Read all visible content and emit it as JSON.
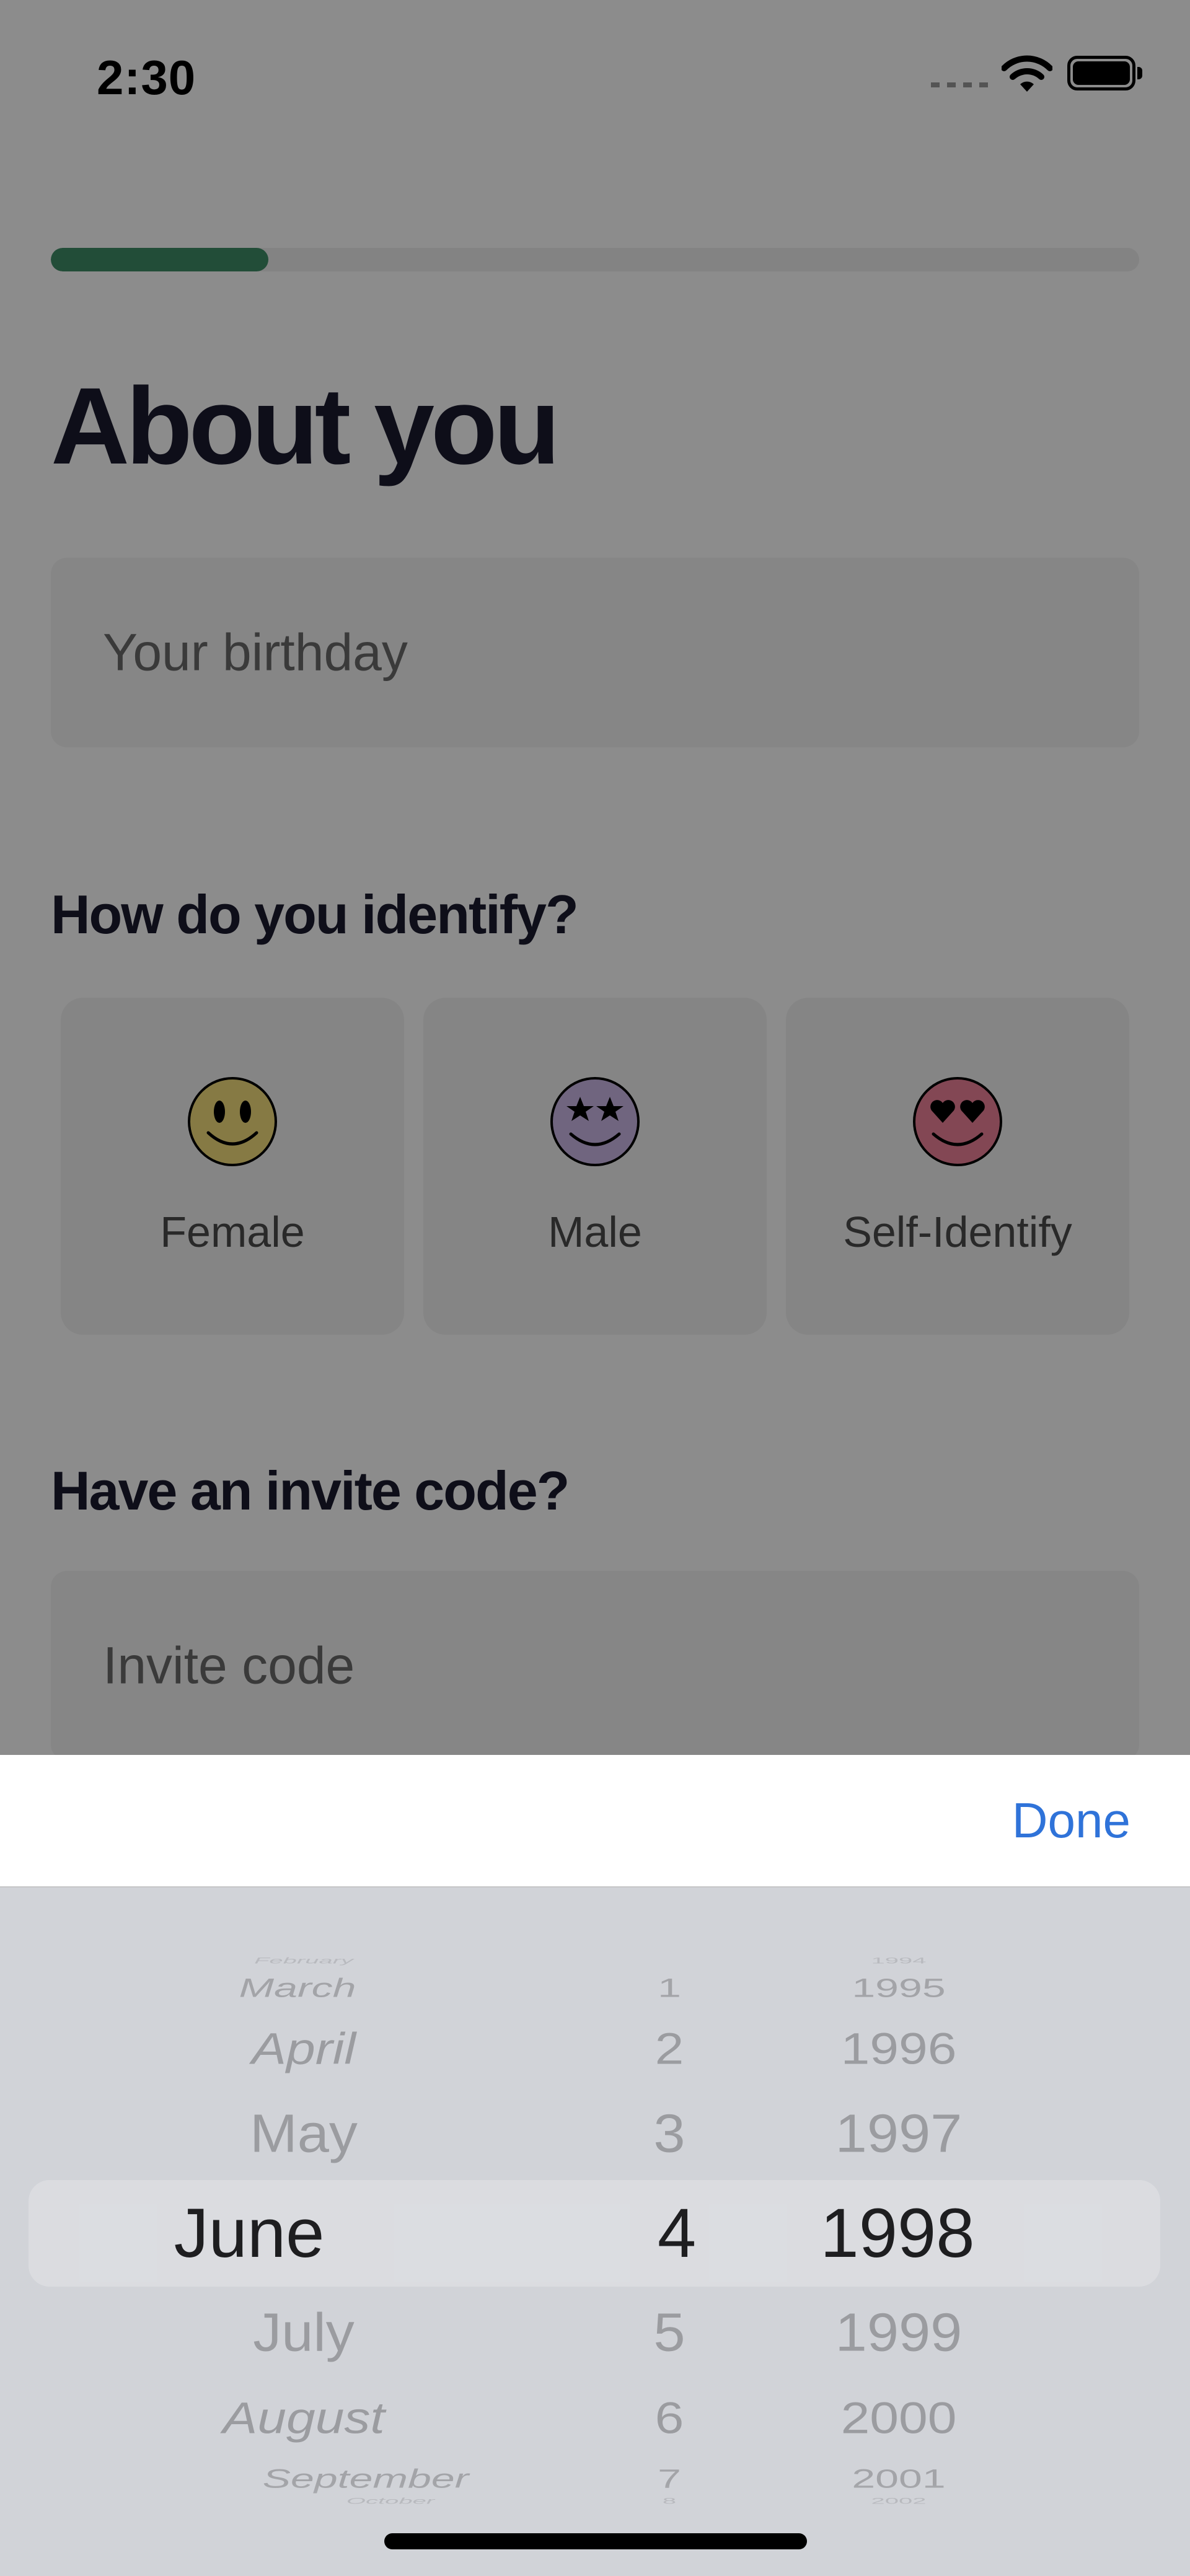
{
  "status_bar": {
    "time": "2:30"
  },
  "progress": {
    "fraction": 0.2
  },
  "page_title": "About you",
  "birthday": {
    "placeholder": "Your birthday"
  },
  "gender": {
    "heading": "How do you identify?",
    "options": [
      {
        "label": "Female",
        "face": "smiley-face-icon",
        "color": "#f5df7c"
      },
      {
        "label": "Male",
        "face": "star-eyes-face-icon",
        "color": "#cdb8e8"
      },
      {
        "label": "Self-Identify",
        "face": "heart-eyes-face-icon",
        "color": "#ef8199"
      }
    ]
  },
  "invite": {
    "heading": "Have an invite code?",
    "placeholder": "Invite code"
  },
  "picker_toolbar": {
    "done_label": "Done"
  },
  "date_picker": {
    "selected": {
      "month": "June",
      "day": "4",
      "year": "1998"
    },
    "months": [
      "February",
      "March",
      "April",
      "May",
      "June",
      "July",
      "August",
      "September",
      "October"
    ],
    "days": [
      "",
      "1",
      "2",
      "3",
      "4",
      "5",
      "6",
      "7",
      "8"
    ],
    "years": [
      "1994",
      "1995",
      "1996",
      "1997",
      "1998",
      "1999",
      "2000",
      "2001",
      "2002"
    ],
    "selected_index": 4
  },
  "colors": {
    "accent": "#3f8c67",
    "link": "#2f73d9",
    "title": "#1b1a2e"
  }
}
